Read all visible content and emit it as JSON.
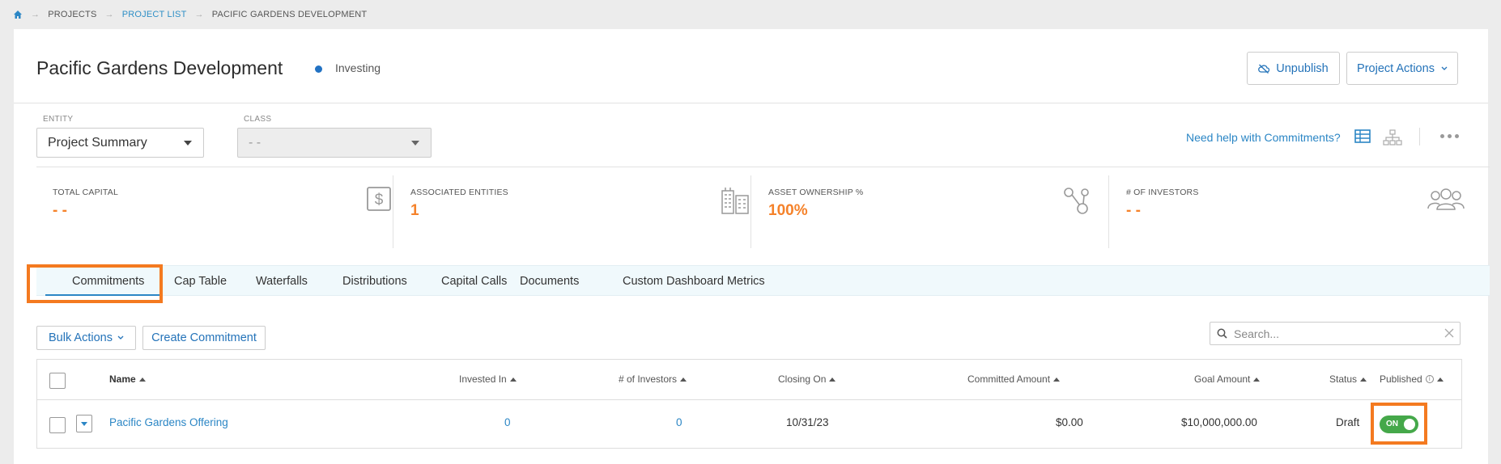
{
  "breadcrumb": {
    "items": [
      "PROJECTS",
      "PROJECT LIST",
      "PACIFIC GARDENS DEVELOPMENT"
    ]
  },
  "header": {
    "title": "Pacific Gardens Development",
    "status": "Investing",
    "status_color": "#2272c3",
    "unpublish_label": "Unpublish",
    "project_actions_label": "Project Actions"
  },
  "filters": {
    "entity_label": "ENTITY",
    "entity_value": "Project Summary",
    "class_label": "CLASS",
    "class_value": "- -",
    "help_link": "Need help with Commitments?"
  },
  "stats": [
    {
      "label": "TOTAL CAPITAL",
      "value": "- -",
      "icon": "dollar-icon"
    },
    {
      "label": "ASSOCIATED ENTITIES",
      "value": "1",
      "icon": "buildings-icon"
    },
    {
      "label": "ASSET OWNERSHIP %",
      "value": "100%",
      "icon": "share-nodes-icon"
    },
    {
      "label": "# OF INVESTORS",
      "value": "- -",
      "icon": "users-icon"
    }
  ],
  "tabs": [
    {
      "label": "Commitments",
      "active": true
    },
    {
      "label": "Cap Table"
    },
    {
      "label": "Waterfalls"
    },
    {
      "label": "Distributions"
    },
    {
      "label": "Capital Calls"
    },
    {
      "label": "Documents"
    },
    {
      "label": "Custom Dashboard Metrics"
    }
  ],
  "toolbar": {
    "bulk_actions_label": "Bulk Actions",
    "create_commitment_label": "Create Commitment",
    "search_placeholder": "Search..."
  },
  "table": {
    "columns": [
      "Name",
      "Invested In",
      "# of Investors",
      "Closing On",
      "Committed Amount",
      "Goal Amount",
      "Status",
      "Published"
    ],
    "rows": [
      {
        "name": "Pacific Gardens Offering",
        "invested_in": "0",
        "investors": "0",
        "closing_on": "10/31/23",
        "committed_amount": "$0.00",
        "goal_amount": "$10,000,000.00",
        "status": "Draft",
        "published": "ON"
      }
    ]
  },
  "colors": {
    "accent": "#2b86c5",
    "highlight": "#f47a20",
    "stat_value": "#f5822a",
    "toggle_on": "#45a84a"
  }
}
